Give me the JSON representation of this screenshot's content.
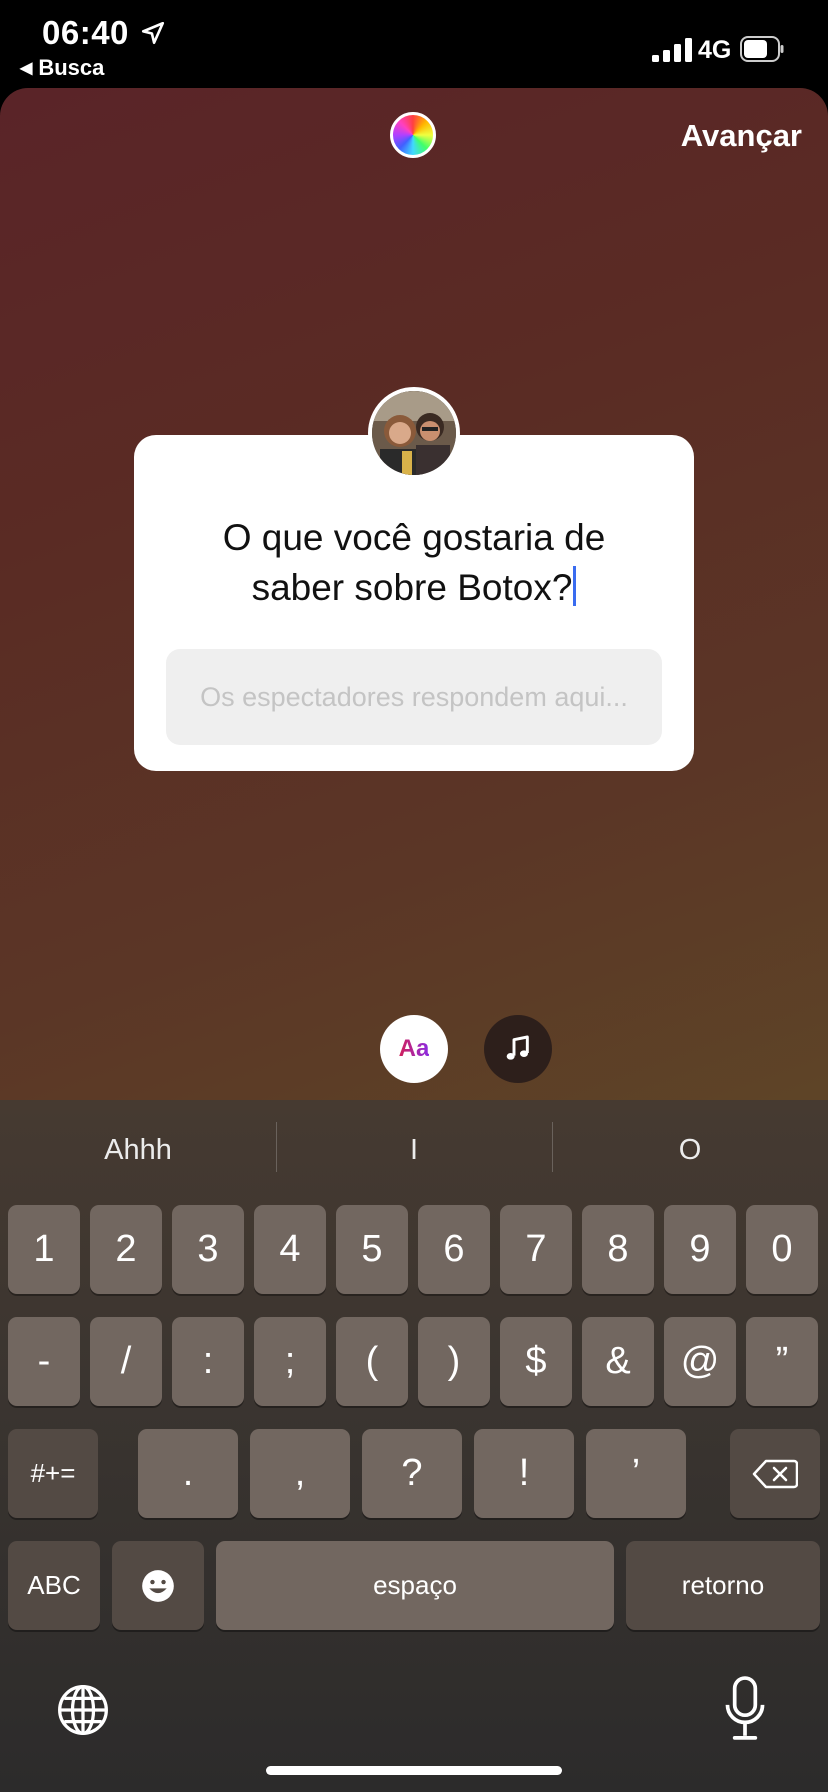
{
  "status_bar": {
    "time": "06:40",
    "back_app": "Busca",
    "network": "4G"
  },
  "top_bar": {
    "next_label": "Avançar"
  },
  "question_sticker": {
    "question_line1": "O que você gostaria de",
    "question_line2": "saber sobre Botox?",
    "answer_placeholder": "Os espectadores respondem aqui..."
  },
  "tools": {
    "text_tool_label": "Aa"
  },
  "keyboard": {
    "suggestions": [
      "Ahhh",
      "I",
      "O"
    ],
    "row1": [
      "1",
      "2",
      "3",
      "4",
      "5",
      "6",
      "7",
      "8",
      "9",
      "0"
    ],
    "row2": [
      "-",
      "/",
      ":",
      ";",
      "(",
      ")",
      "$",
      "&",
      "@",
      "”"
    ],
    "row3_left": "#+=",
    "row3": [
      ".",
      ",",
      "?",
      "!",
      "’"
    ],
    "abc_label": "ABC",
    "space_label": "espaço",
    "return_label": "retorno"
  }
}
